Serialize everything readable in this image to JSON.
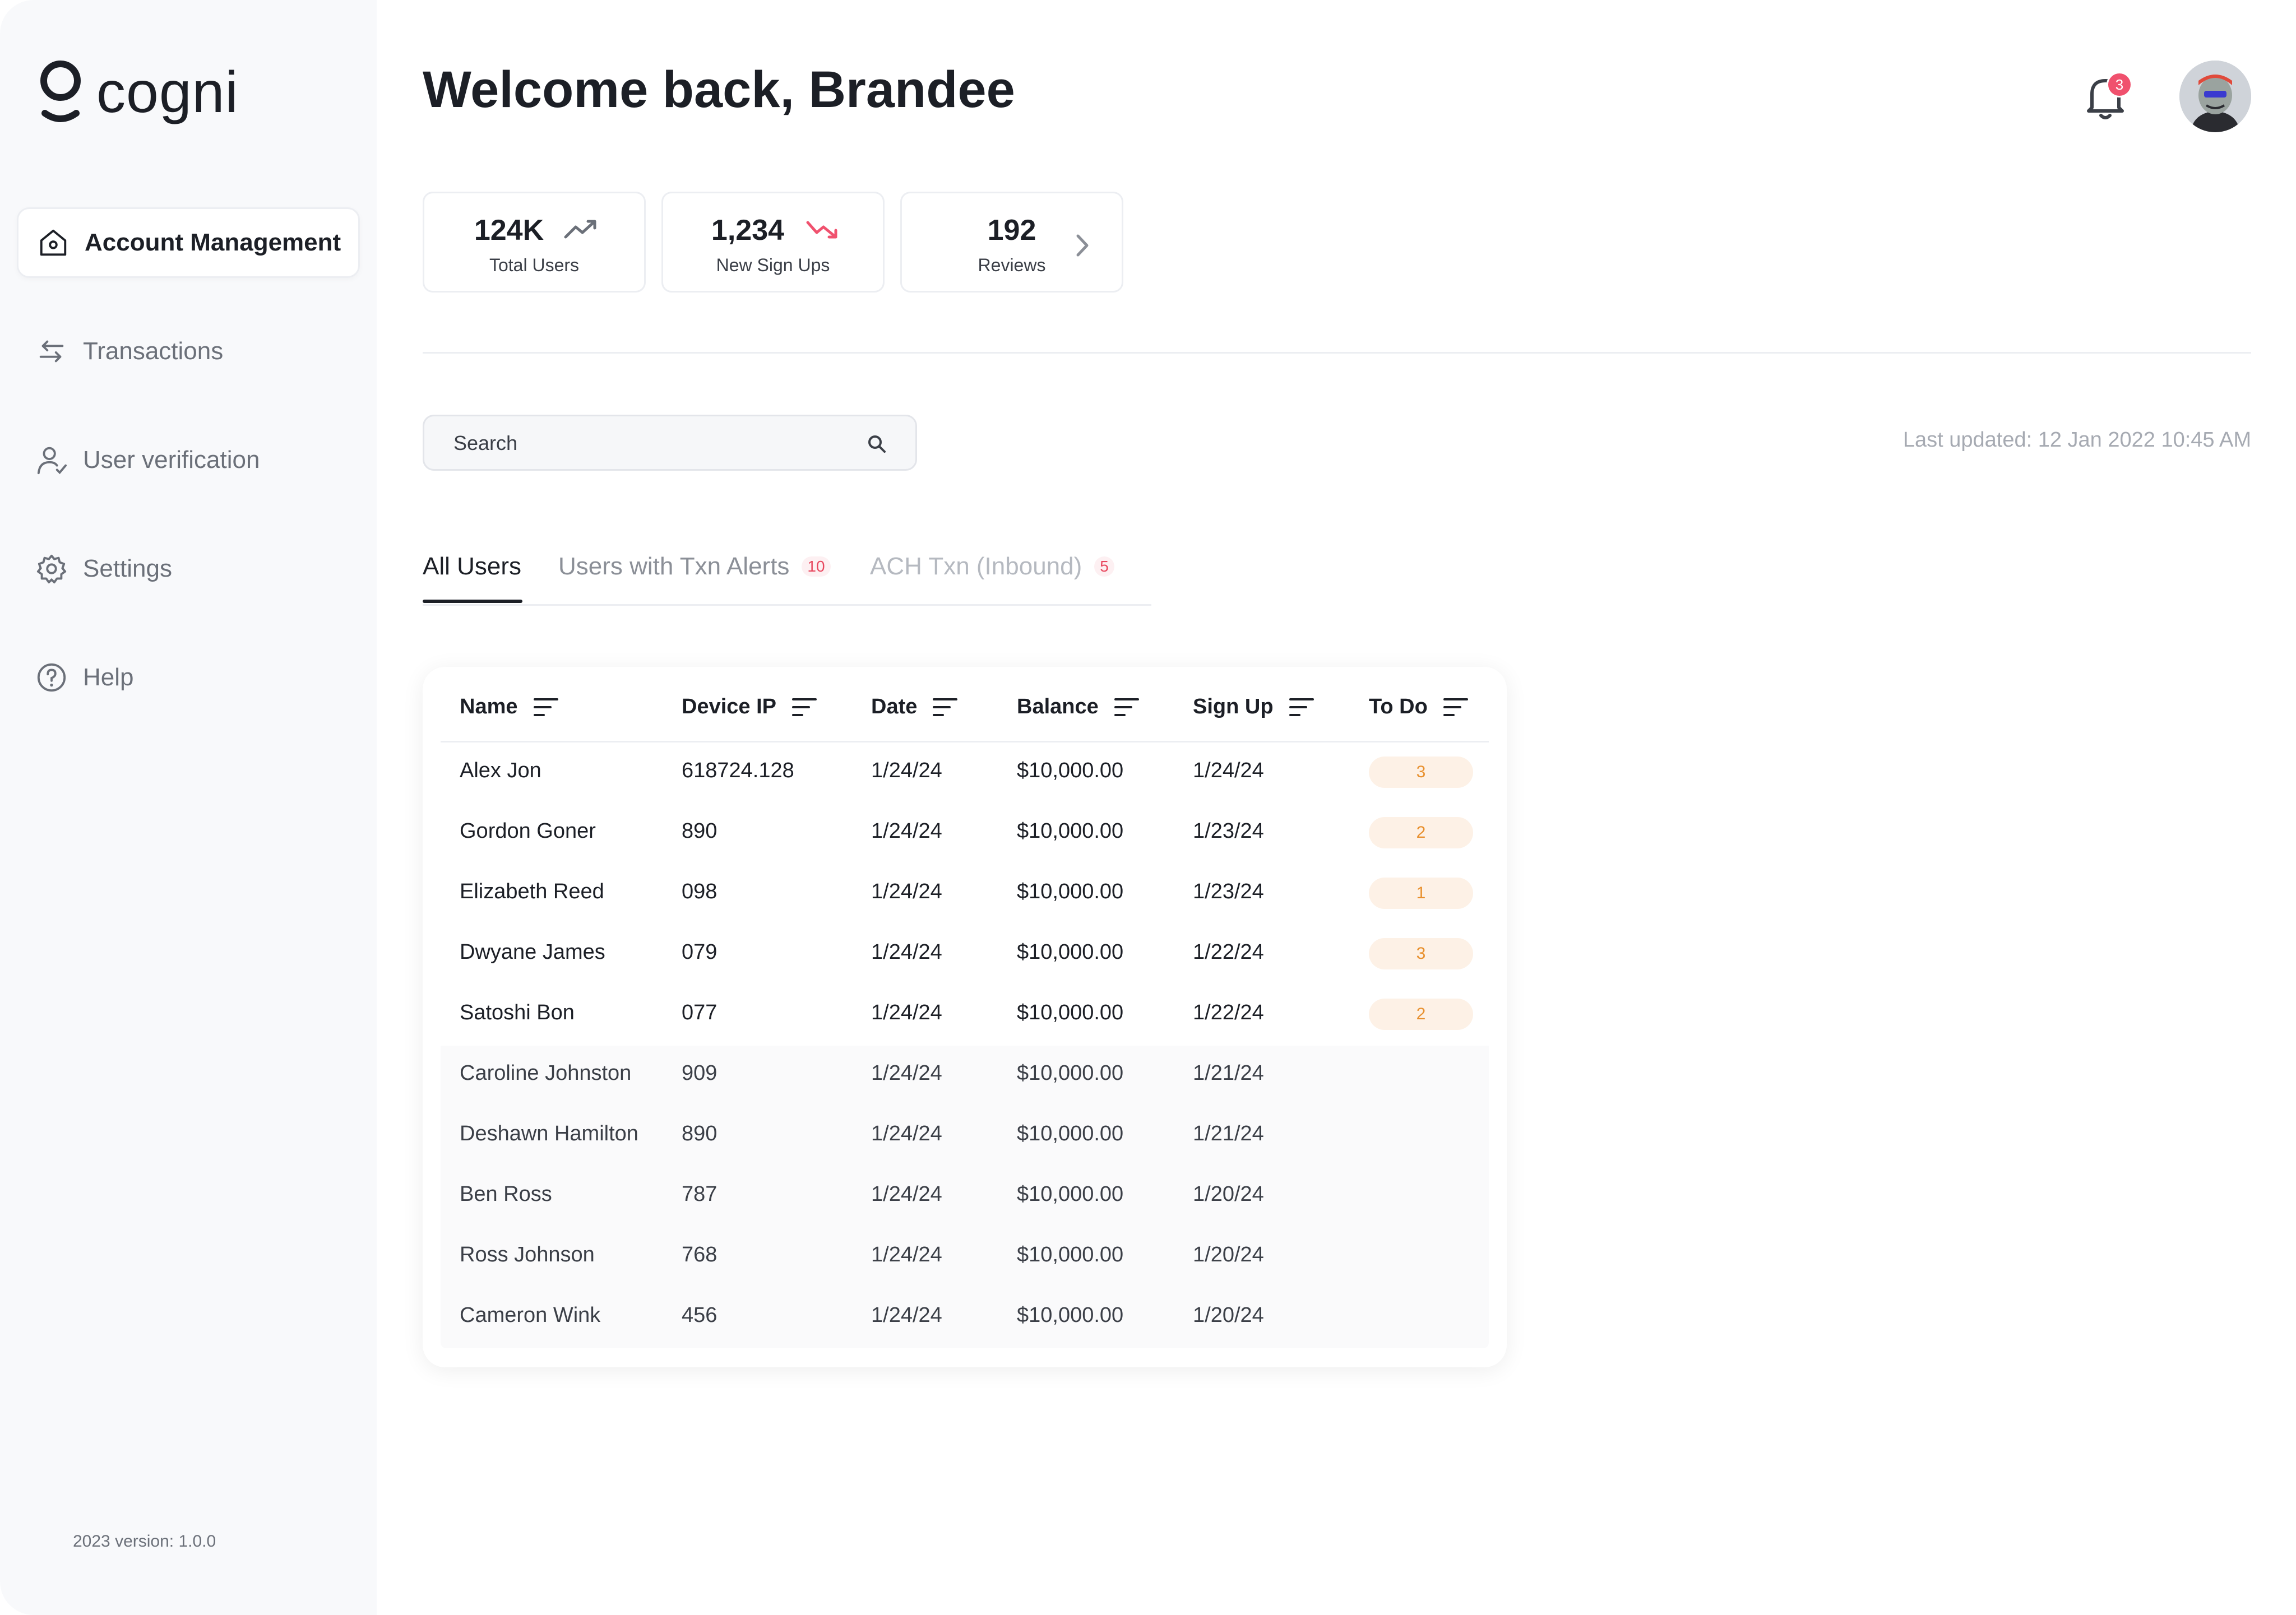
{
  "app": {
    "logo_text": "cogni",
    "version": "2023 version: 1.0.0"
  },
  "sidebar": {
    "items": [
      {
        "label": "Account Management",
        "icon": "home-icon",
        "active": true
      },
      {
        "label": "Transactions",
        "icon": "swap-arrows-icon"
      },
      {
        "label": "User verification",
        "icon": "user-check-icon"
      },
      {
        "label": "Settings",
        "icon": "gear-icon"
      },
      {
        "label": "Help",
        "icon": "help-circle-icon"
      }
    ]
  },
  "header": {
    "welcome": "Welcome back, Brandee",
    "notification_count": "3"
  },
  "stats": [
    {
      "value": "124K",
      "label": "Total Users",
      "trend": "up"
    },
    {
      "value": "1,234",
      "label": "New Sign Ups",
      "trend": "down"
    },
    {
      "value": "192",
      "label": "Reviews",
      "trend": "none"
    }
  ],
  "search": {
    "placeholder": "Search"
  },
  "last_updated": "Last updated: 12 Jan 2022 10:45 AM",
  "tabs": [
    {
      "label": "All Users",
      "count": "",
      "active": true
    },
    {
      "label": "Users with Txn Alerts",
      "count": "10"
    },
    {
      "label": "ACH Txn (Inbound)",
      "count": "5"
    }
  ],
  "table": {
    "columns": [
      "Name",
      "Device IP",
      "Date",
      "Balance",
      "Sign Up",
      "To Do"
    ],
    "rows": [
      {
        "name": "Alex Jon",
        "ip": "618724.128",
        "date": "1/24/24",
        "balance": "$10,000.00",
        "signup": "1/24/24",
        "todo": "3"
      },
      {
        "name": "Gordon Goner",
        "ip": "890",
        "date": "1/24/24",
        "balance": "$10,000.00",
        "signup": "1/23/24",
        "todo": "2"
      },
      {
        "name": "Elizabeth Reed",
        "ip": "098",
        "date": "1/24/24",
        "balance": "$10,000.00",
        "signup": "1/23/24",
        "todo": "1"
      },
      {
        "name": "Dwyane James",
        "ip": "079",
        "date": "1/24/24",
        "balance": "$10,000.00",
        "signup": "1/22/24",
        "todo": "3"
      },
      {
        "name": "Satoshi Bon",
        "ip": "077",
        "date": "1/24/24",
        "balance": "$10,000.00",
        "signup": "1/22/24",
        "todo": "2"
      },
      {
        "name": "Caroline Johnston",
        "ip": "909",
        "date": "1/24/24",
        "balance": "$10,000.00",
        "signup": "1/21/24",
        "todo": ""
      },
      {
        "name": "Deshawn Hamilton",
        "ip": "890",
        "date": "1/24/24",
        "balance": "$10,000.00",
        "signup": "1/21/24",
        "todo": ""
      },
      {
        "name": "Ben Ross",
        "ip": "787",
        "date": "1/24/24",
        "balance": "$10,000.00",
        "signup": "1/20/24",
        "todo": ""
      },
      {
        "name": "Ross Johnson",
        "ip": "768",
        "date": "1/24/24",
        "balance": "$10,000.00",
        "signup": "1/20/24",
        "todo": ""
      },
      {
        "name": "Cameron Wink",
        "ip": "456",
        "date": "1/24/24",
        "balance": "$10,000.00",
        "signup": "1/20/24",
        "todo": ""
      }
    ]
  },
  "colors": {
    "accent_red": "#f0516e",
    "todo_orange": "#e8902e",
    "todo_bg": "#fdf1e6",
    "text": "#1c1f26"
  }
}
